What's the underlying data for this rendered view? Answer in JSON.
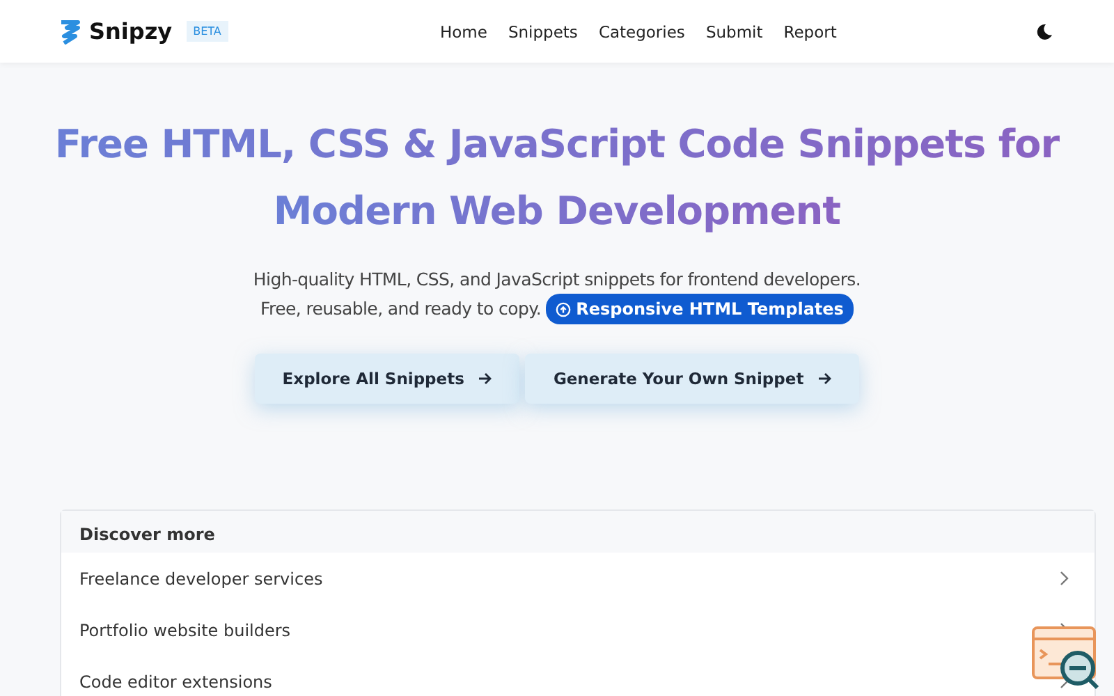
{
  "header": {
    "brand": "Snipzy",
    "badge": "BETA",
    "nav": [
      "Home",
      "Snippets",
      "Categories",
      "Submit",
      "Report"
    ]
  },
  "hero": {
    "title_lines": [
      "Free HTML, CSS & JavaScript Code Snippets for",
      "Modern Web Development"
    ],
    "subtitle_lines": [
      "High-quality HTML, CSS, and JavaScript snippets for frontend developers.",
      "Free, reusable, and ready to copy."
    ],
    "chip": "Responsive HTML Templates",
    "buttons": [
      "Explore All Snippets",
      "Generate Your Own Snippet"
    ]
  },
  "discover": {
    "title": "Discover more",
    "items": [
      "Freelance developer services",
      "Portfolio website builders",
      "Code editor extensions"
    ]
  }
}
